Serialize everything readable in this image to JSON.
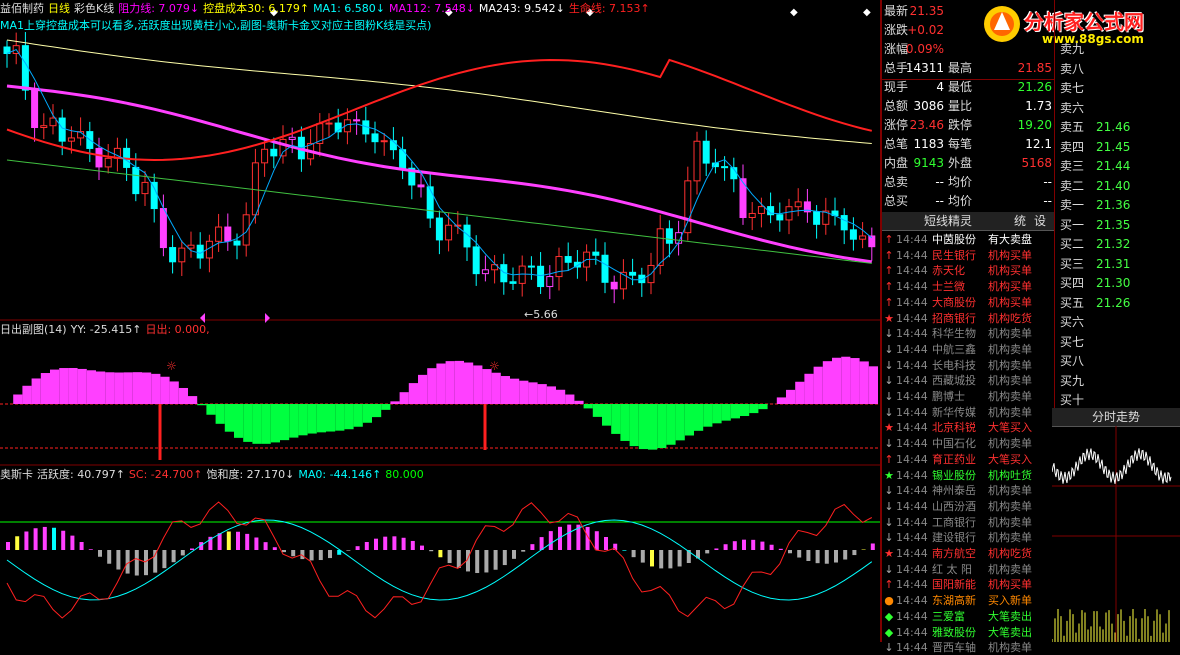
{
  "panel1": {
    "items": [
      {
        "text": "益佰制药",
        "color": "#dddddd"
      },
      {
        "text": "日线",
        "color": "#ffff00"
      },
      {
        "text": "彩色K线",
        "color": "#dddddd"
      },
      {
        "text": "阻力线: 7.079↓",
        "color": "#ff00ff"
      },
      {
        "text": "控盘成本30: 6.179↑",
        "color": "#ffff00"
      },
      {
        "text": "MA1: 6.580↓",
        "color": "#00ffff"
      },
      {
        "text": "MA112: 7.548↓",
        "color": "#ff00ff"
      },
      {
        "text": "MA243: 9.542↓",
        "color": "#ffffff"
      },
      {
        "text": "生命线: 7.153↑",
        "color": "#ff2020"
      }
    ],
    "note": "MA1上穿控盘成本可以看多,活跃度出现黄柱小心,副图-奥斯卡金叉对应主图粉K线是买点)",
    "low_label": "←5.66"
  },
  "panel2": {
    "items": [
      {
        "text": "日出副图(14)",
        "color": "#dddddd"
      },
      {
        "text": "YY: -25.415↑",
        "color": "#dddddd"
      },
      {
        "text": "日出: 0.000,",
        "color": "#ff3030"
      }
    ]
  },
  "panel3": {
    "items": [
      {
        "text": "奥斯卡",
        "color": "#dddddd"
      },
      {
        "text": "活跃度: 40.797↑",
        "color": "#dddddd"
      },
      {
        "text": "SC: -24.700↑",
        "color": "#ff3030"
      },
      {
        "text": "饱和度: 27.170↓",
        "color": "#dddddd"
      },
      {
        "text": "MA0: -44.146↑",
        "color": "#00ffff"
      },
      {
        "text": "80.000",
        "color": "#00ff00"
      }
    ]
  },
  "quote": [
    {
      "l1": "最新",
      "v1": "21.35",
      "c1": "#ff3030",
      "l2": "",
      "v2": "",
      "c2": "#ddd"
    },
    {
      "l1": "涨跌",
      "v1": "+0.02",
      "c1": "#ff3030",
      "l2": "",
      "v2": "",
      "c2": "#ddd"
    },
    {
      "l1": "涨幅",
      "v1": "0.09%",
      "c1": "#ff3030",
      "l2": "",
      "v2": "",
      "c2": "#ddd"
    },
    {
      "l1": "总手",
      "v1": "14311",
      "c1": "#ffffff",
      "l2": "最高",
      "v2": "21.85",
      "c2": "#ff3030"
    },
    {
      "l1": "现手",
      "v1": "4",
      "c1": "#ffffff",
      "l2": "最低",
      "v2": "21.26",
      "c2": "#30ff30"
    },
    {
      "l1": "总额",
      "v1": "3086",
      "c1": "#ffffff",
      "l2": "量比",
      "v2": "1.73",
      "c2": "#ffffff"
    },
    {
      "l1": "涨停",
      "v1": "23.46",
      "c1": "#ff3030",
      "l2": "跌停",
      "v2": "19.20",
      "c2": "#30ff30"
    },
    {
      "l1": "总笔",
      "v1": "1183",
      "c1": "#ffffff",
      "l2": "每笔",
      "v2": "12.1",
      "c2": "#ffffff"
    },
    {
      "l1": "内盘",
      "v1": "9143",
      "c1": "#30ff30",
      "l2": "外盘",
      "v2": "5168",
      "c2": "#ff3030"
    },
    {
      "l1": "总卖",
      "v1": "--",
      "c1": "#ffffff",
      "l2": "均价",
      "v2": "--",
      "c2": "#ffffff"
    },
    {
      "l1": "总买",
      "v1": "--",
      "c1": "#ffffff",
      "l2": "均价",
      "v2": "--",
      "c2": "#ffffff"
    }
  ],
  "orderbook": [
    {
      "label": "卖九",
      "value": ""
    },
    {
      "label": "卖八",
      "value": ""
    },
    {
      "label": "卖七",
      "value": ""
    },
    {
      "label": "卖六",
      "value": ""
    },
    {
      "label": "卖五",
      "value": "21.46"
    },
    {
      "label": "卖四",
      "value": "21.45"
    },
    {
      "label": "卖三",
      "value": "21.44"
    },
    {
      "label": "卖二",
      "value": "21.40"
    },
    {
      "label": "卖一",
      "value": "21.36"
    },
    {
      "label": "买一",
      "value": "21.35"
    },
    {
      "label": "买二",
      "value": "21.32"
    },
    {
      "label": "买三",
      "value": "21.31"
    },
    {
      "label": "买四",
      "value": "21.30"
    },
    {
      "label": "买五",
      "value": "21.26"
    },
    {
      "label": "买六",
      "value": ""
    },
    {
      "label": "买七",
      "value": ""
    },
    {
      "label": "买八",
      "value": ""
    },
    {
      "label": "买九",
      "value": ""
    },
    {
      "label": "买十",
      "value": ""
    }
  ],
  "tape_tabs": {
    "tab1": "短线精灵",
    "tab2": "统",
    "tab3": "设"
  },
  "tape": [
    {
      "mark": "↑",
      "mc": "#ff3030",
      "time": "14:44",
      "name": "中茵股份",
      "nc": "#ffffff",
      "action": "有大卖盘",
      "ac": "#ffffff"
    },
    {
      "mark": "↑",
      "mc": "#ff3030",
      "time": "14:44",
      "name": "民生银行",
      "nc": "#ff3030",
      "action": "机构买单",
      "ac": "#ff3030"
    },
    {
      "mark": "↑",
      "mc": "#ff3030",
      "time": "14:44",
      "name": "赤天化",
      "nc": "#ff3030",
      "action": "机构买单",
      "ac": "#ff3030"
    },
    {
      "mark": "↑",
      "mc": "#ff3030",
      "time": "14:44",
      "name": "士兰微",
      "nc": "#ff3030",
      "action": "机构买单",
      "ac": "#ff3030"
    },
    {
      "mark": "↑",
      "mc": "#ff3030",
      "time": "14:44",
      "name": "大商股份",
      "nc": "#ff3030",
      "action": "机构买单",
      "ac": "#ff3030"
    },
    {
      "mark": "★",
      "mc": "#ff3030",
      "time": "14:44",
      "name": "招商银行",
      "nc": "#ff3030",
      "action": "机构吃货",
      "ac": "#ff3030"
    },
    {
      "mark": "↓",
      "mc": "#aaaaaa",
      "time": "14:44",
      "name": "科华生物",
      "nc": "#888888",
      "action": "机构卖单",
      "ac": "#888888"
    },
    {
      "mark": "↓",
      "mc": "#aaaaaa",
      "time": "14:44",
      "name": "中航三鑫",
      "nc": "#888888",
      "action": "机构卖单",
      "ac": "#888888"
    },
    {
      "mark": "↓",
      "mc": "#aaaaaa",
      "time": "14:44",
      "name": "长电科技",
      "nc": "#888888",
      "action": "机构卖单",
      "ac": "#888888"
    },
    {
      "mark": "↓",
      "mc": "#aaaaaa",
      "time": "14:44",
      "name": "西藏城投",
      "nc": "#888888",
      "action": "机构卖单",
      "ac": "#888888"
    },
    {
      "mark": "↓",
      "mc": "#aaaaaa",
      "time": "14:44",
      "name": "鹏博士",
      "nc": "#888888",
      "action": "机构卖单",
      "ac": "#888888"
    },
    {
      "mark": "↓",
      "mc": "#aaaaaa",
      "time": "14:44",
      "name": "新华传媒",
      "nc": "#888888",
      "action": "机构卖单",
      "ac": "#888888"
    },
    {
      "mark": "★",
      "mc": "#ff3030",
      "time": "14:44",
      "name": "北京科锐",
      "nc": "#ff3030",
      "action": "大笔买入",
      "ac": "#ff3030"
    },
    {
      "mark": "↓",
      "mc": "#aaaaaa",
      "time": "14:44",
      "name": "中国石化",
      "nc": "#888888",
      "action": "机构卖单",
      "ac": "#888888"
    },
    {
      "mark": "↑",
      "mc": "#ff3030",
      "time": "14:44",
      "name": "育正药业",
      "nc": "#ff3030",
      "action": "大笔买入",
      "ac": "#ff3030"
    },
    {
      "mark": "★",
      "mc": "#30ff30",
      "time": "14:44",
      "name": "锡业股份",
      "nc": "#30ff30",
      "action": "机构吐货",
      "ac": "#30ff30"
    },
    {
      "mark": "↓",
      "mc": "#aaaaaa",
      "time": "14:44",
      "name": "神州泰岳",
      "nc": "#888888",
      "action": "机构卖单",
      "ac": "#888888"
    },
    {
      "mark": "↓",
      "mc": "#aaaaaa",
      "time": "14:44",
      "name": "山西汾酒",
      "nc": "#888888",
      "action": "机构卖单",
      "ac": "#888888"
    },
    {
      "mark": "↓",
      "mc": "#aaaaaa",
      "time": "14:44",
      "name": "工商银行",
      "nc": "#888888",
      "action": "机构卖单",
      "ac": "#888888"
    },
    {
      "mark": "↓",
      "mc": "#aaaaaa",
      "time": "14:44",
      "name": "建设银行",
      "nc": "#888888",
      "action": "机构卖单",
      "ac": "#888888"
    },
    {
      "mark": "★",
      "mc": "#ff3030",
      "time": "14:44",
      "name": "南方航空",
      "nc": "#ff3030",
      "action": "机构吃货",
      "ac": "#ff3030"
    },
    {
      "mark": "↓",
      "mc": "#aaaaaa",
      "time": "14:44",
      "name": "红 太 阳",
      "nc": "#888888",
      "action": "机构卖单",
      "ac": "#888888"
    },
    {
      "mark": "↑",
      "mc": "#ff3030",
      "time": "14:44",
      "name": "国阳新能",
      "nc": "#ff3030",
      "action": "机构买单",
      "ac": "#ff3030"
    },
    {
      "mark": "●",
      "mc": "#ff8800",
      "time": "14:44",
      "name": "东湖高新",
      "nc": "#ff8800",
      "action": "买入新单",
      "ac": "#ff8800"
    },
    {
      "mark": "◆",
      "mc": "#30ff30",
      "time": "14:44",
      "name": "三爱富",
      "nc": "#30ff30",
      "action": "大笔卖出",
      "ac": "#30ff30"
    },
    {
      "mark": "◆",
      "mc": "#30ff30",
      "time": "14:44",
      "name": "雅致股份",
      "nc": "#30ff30",
      "action": "大笔卖出",
      "ac": "#30ff30"
    },
    {
      "mark": "↓",
      "mc": "#aaaaaa",
      "time": "14:44",
      "name": "晋西车轴",
      "nc": "#888888",
      "action": "机构卖单",
      "ac": "#888888"
    }
  ],
  "minichart_title": "分时走势",
  "logo": {
    "text": "分析家公式网",
    "url": "www.88gs.com"
  },
  "colors": {
    "up": "#ff3030",
    "down": "#00ffff",
    "grid": "#800000"
  }
}
